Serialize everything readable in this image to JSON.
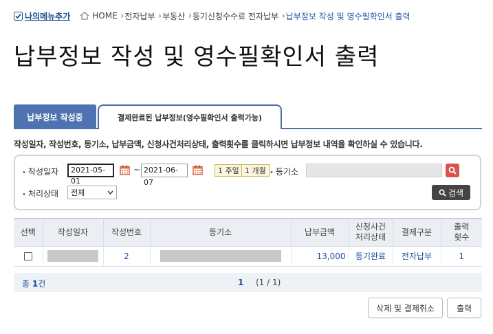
{
  "top": {
    "my_menu_label": "나의메뉴추가",
    "breadcrumb": [
      "HOME",
      "전자납부",
      "부동산",
      "등기신청수수료 전자납부"
    ],
    "breadcrumb_current": "납부정보 작성 및 영수필확인서 출력"
  },
  "page_title": "납부정보 작성 및 영수필확인서 출력",
  "tabs": [
    {
      "label": "납부정보 작성중",
      "active": true
    },
    {
      "label": "결제완료된 납부정보(영수필확인서 출력가능)",
      "active": false
    }
  ],
  "description": "작성일자, 작성번호, 등기소, 납부금액, 신청사건처리상태, 출력횟수를 클릭하시면 납부정보 내역을 확인하실 수 있습니다.",
  "search": {
    "date_label": "작성일자",
    "date_from": "2021-05-01",
    "date_to": "2021-06-07",
    "tilde": "~",
    "period_buttons": [
      "1 주일",
      "1 개월"
    ],
    "registry_label": "등기소",
    "registry_value": "",
    "status_label": "처리상태",
    "status_value": "전체",
    "search_button": "검색"
  },
  "table": {
    "headers": [
      "선택",
      "작성일자",
      "작성번호",
      "등기소",
      "납부금액",
      "신청사건\n처리상태",
      "결제구분",
      "출력\n횟수"
    ],
    "rows": [
      {
        "number": "2",
        "amount": "13,000",
        "status": "등기완료",
        "payment_type": "전자납부",
        "print_count": "1"
      }
    ]
  },
  "paging": {
    "total_prefix": "총",
    "total_count": "1",
    "total_suffix": "건",
    "current_page": "1",
    "page_info": "(1 / 1)"
  },
  "buttons": {
    "delete_cancel": "삭제 및 결제취소",
    "print": "출력"
  },
  "colors": {
    "accent_blue": "#4f73b0",
    "link_blue": "#1f4fa0",
    "search_red": "#d9534f"
  }
}
